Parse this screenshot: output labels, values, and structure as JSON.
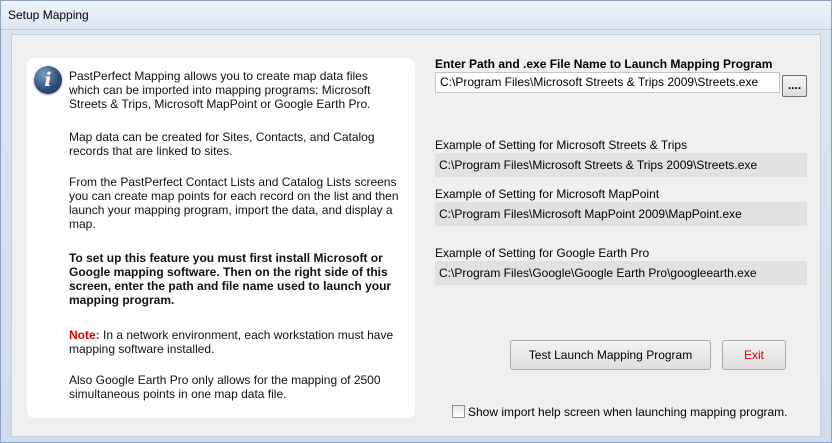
{
  "window": {
    "title": "Setup Mapping"
  },
  "info": {
    "icon": "info-icon",
    "paragraph1": "PastPerfect Mapping allows you to create map data files which can be imported into mapping programs: Microsoft Streets & Trips, Microsoft MapPoint or Google Earth Pro.",
    "paragraph2": "Map data can be created for Sites, Contacts, and Catalog records that are linked to sites.",
    "paragraph3": "From the PastPerfect Contact Lists and Catalog Lists screens you can create map points for each record on the list and then launch your mapping program, import the data, and display a map.",
    "paragraph4": "To set up this feature you must first install Microsoft or Google mapping software. Then on the right side of this screen, enter the path and file name used to launch your mapping program.",
    "note_label": "Note:",
    "note_text": " In a network environment, each workstation must have mapping software installed.",
    "paragraph6": "Also Google Earth Pro only allows for the mapping of 2500 simultaneous points in one map data file."
  },
  "path": {
    "label": "Enter Path and .exe File Name to Launch Mapping Program",
    "value": "C:\\Program Files\\Microsoft Streets & Trips 2009\\Streets.exe",
    "browse_label": "...."
  },
  "examples": [
    {
      "label": "Example of Setting for Microsoft Streets & Trips",
      "value": "C:\\Program Files\\Microsoft Streets & Trips 2009\\Streets.exe"
    },
    {
      "label": "Example of Setting for Microsoft MapPoint",
      "value": "C:\\Program Files\\Microsoft MapPoint 2009\\MapPoint.exe"
    },
    {
      "label": "Example of Setting for Google Earth Pro",
      "value": "C:\\Program Files\\Google\\Google Earth Pro\\googleearth.exe"
    }
  ],
  "buttons": {
    "test_launch": "Test Launch Mapping Program",
    "exit": "Exit"
  },
  "checkbox": {
    "label": "Show import help screen when launching mapping program.",
    "checked": false
  }
}
